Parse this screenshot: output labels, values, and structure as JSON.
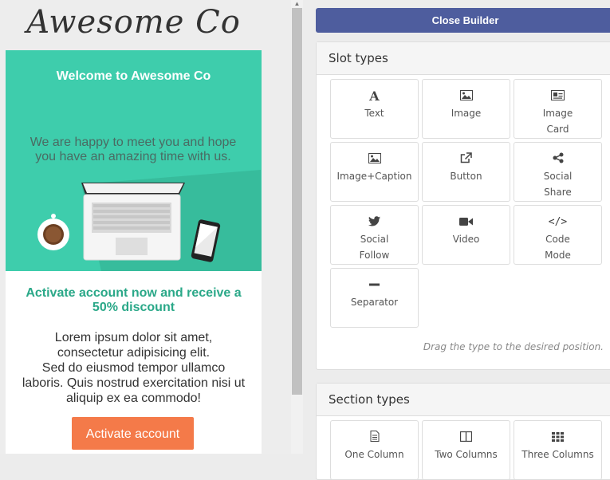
{
  "email": {
    "logo": "Awesome Co",
    "hero_title": "Welcome to Awesome Co",
    "hero_text": "We are happy to meet you and hope you have an amazing time with us.",
    "activate_title": "Activate account now and receive a 50% discount",
    "body_lines": [
      "Lorem ipsum dolor sit amet,",
      "consectetur adipisicing elit.",
      "Sed do eiusmod tempor ullamco",
      "laboris. Quis nostrud exercitation nisi ut",
      "aliquip ex ea commodo!"
    ],
    "button_label": "Activate account"
  },
  "builder": {
    "close_label": "Close Builder",
    "slot_types_title": "Slot types",
    "slot_types": [
      {
        "icon": "text-icon",
        "lines": [
          "Text"
        ]
      },
      {
        "icon": "image-icon",
        "lines": [
          "Image"
        ]
      },
      {
        "icon": "image-card-icon",
        "lines": [
          "Image",
          "Card"
        ]
      },
      {
        "icon": "image-icon",
        "lines": [
          "Image+Caption"
        ]
      },
      {
        "icon": "external-link-icon",
        "lines": [
          "Button"
        ]
      },
      {
        "icon": "share-icon",
        "lines": [
          "Social",
          "Share"
        ]
      },
      {
        "icon": "twitter-icon",
        "lines": [
          "Social",
          "Follow"
        ]
      },
      {
        "icon": "video-camera-icon",
        "lines": [
          "Video"
        ]
      },
      {
        "icon": "code-icon",
        "lines": [
          "Code",
          "Mode"
        ]
      },
      {
        "icon": "minus-icon",
        "lines": [
          "Separator"
        ]
      }
    ],
    "hint": "Drag the type to the desired position.",
    "section_types_title": "Section types",
    "section_types": [
      {
        "icon": "document-icon",
        "label": "One Column"
      },
      {
        "icon": "columns-icon",
        "label": "Two Columns"
      },
      {
        "icon": "grid-icon",
        "label": "Three Columns"
      }
    ]
  },
  "colors": {
    "hero": "#3ecdac",
    "accent": "#2aa888",
    "button": "#f47a49",
    "builder_button": "#4e5d9e"
  }
}
